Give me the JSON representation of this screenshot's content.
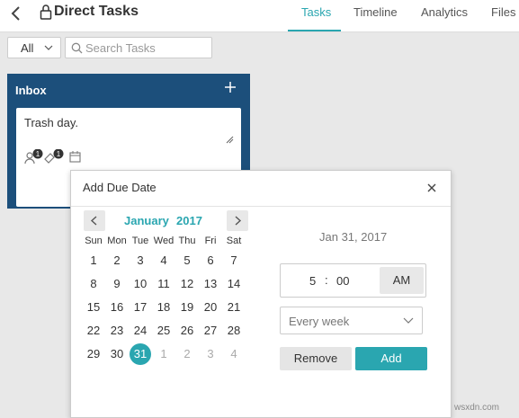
{
  "header": {
    "title": "Direct Tasks",
    "tabs": [
      {
        "label": "Tasks"
      },
      {
        "label": "Timeline"
      },
      {
        "label": "Analytics"
      },
      {
        "label": "Files"
      }
    ]
  },
  "filter": {
    "selected": "All",
    "search_placeholder": "Search Tasks"
  },
  "board": {
    "title": "Inbox",
    "card": {
      "text": "Trash day.",
      "badges": {
        "assignees": "1",
        "tags": "1"
      }
    }
  },
  "dialog": {
    "title": "Add Due Date",
    "month": "January",
    "year": "2017",
    "weekdays": [
      "Sun",
      "Mon",
      "Tue",
      "Wed",
      "Thu",
      "Fri",
      "Sat"
    ],
    "weeks": [
      [
        {
          "d": "1"
        },
        {
          "d": "2"
        },
        {
          "d": "3"
        },
        {
          "d": "4"
        },
        {
          "d": "5"
        },
        {
          "d": "6"
        },
        {
          "d": "7"
        }
      ],
      [
        {
          "d": "8"
        },
        {
          "d": "9"
        },
        {
          "d": "10"
        },
        {
          "d": "11"
        },
        {
          "d": "12"
        },
        {
          "d": "13"
        },
        {
          "d": "14"
        }
      ],
      [
        {
          "d": "15"
        },
        {
          "d": "16"
        },
        {
          "d": "17"
        },
        {
          "d": "18"
        },
        {
          "d": "19"
        },
        {
          "d": "20"
        },
        {
          "d": "21"
        }
      ],
      [
        {
          "d": "22"
        },
        {
          "d": "23"
        },
        {
          "d": "24"
        },
        {
          "d": "25"
        },
        {
          "d": "26"
        },
        {
          "d": "27"
        },
        {
          "d": "28"
        }
      ],
      [
        {
          "d": "29"
        },
        {
          "d": "30"
        },
        {
          "d": "31",
          "selected": true
        },
        {
          "d": "1",
          "muted": true
        },
        {
          "d": "2",
          "muted": true
        },
        {
          "d": "3",
          "muted": true
        },
        {
          "d": "4",
          "muted": true
        }
      ]
    ],
    "selected_date_display": "Jan 31, 2017",
    "time": {
      "hour": "5",
      "separator": ":",
      "minute": "00",
      "period": "AM"
    },
    "repeat": "Every week",
    "remove_label": "Remove",
    "add_label": "Add"
  },
  "watermark": "wsxdn.com",
  "colors": {
    "accent": "#2aa6b0",
    "board": "#1c4f7b"
  }
}
